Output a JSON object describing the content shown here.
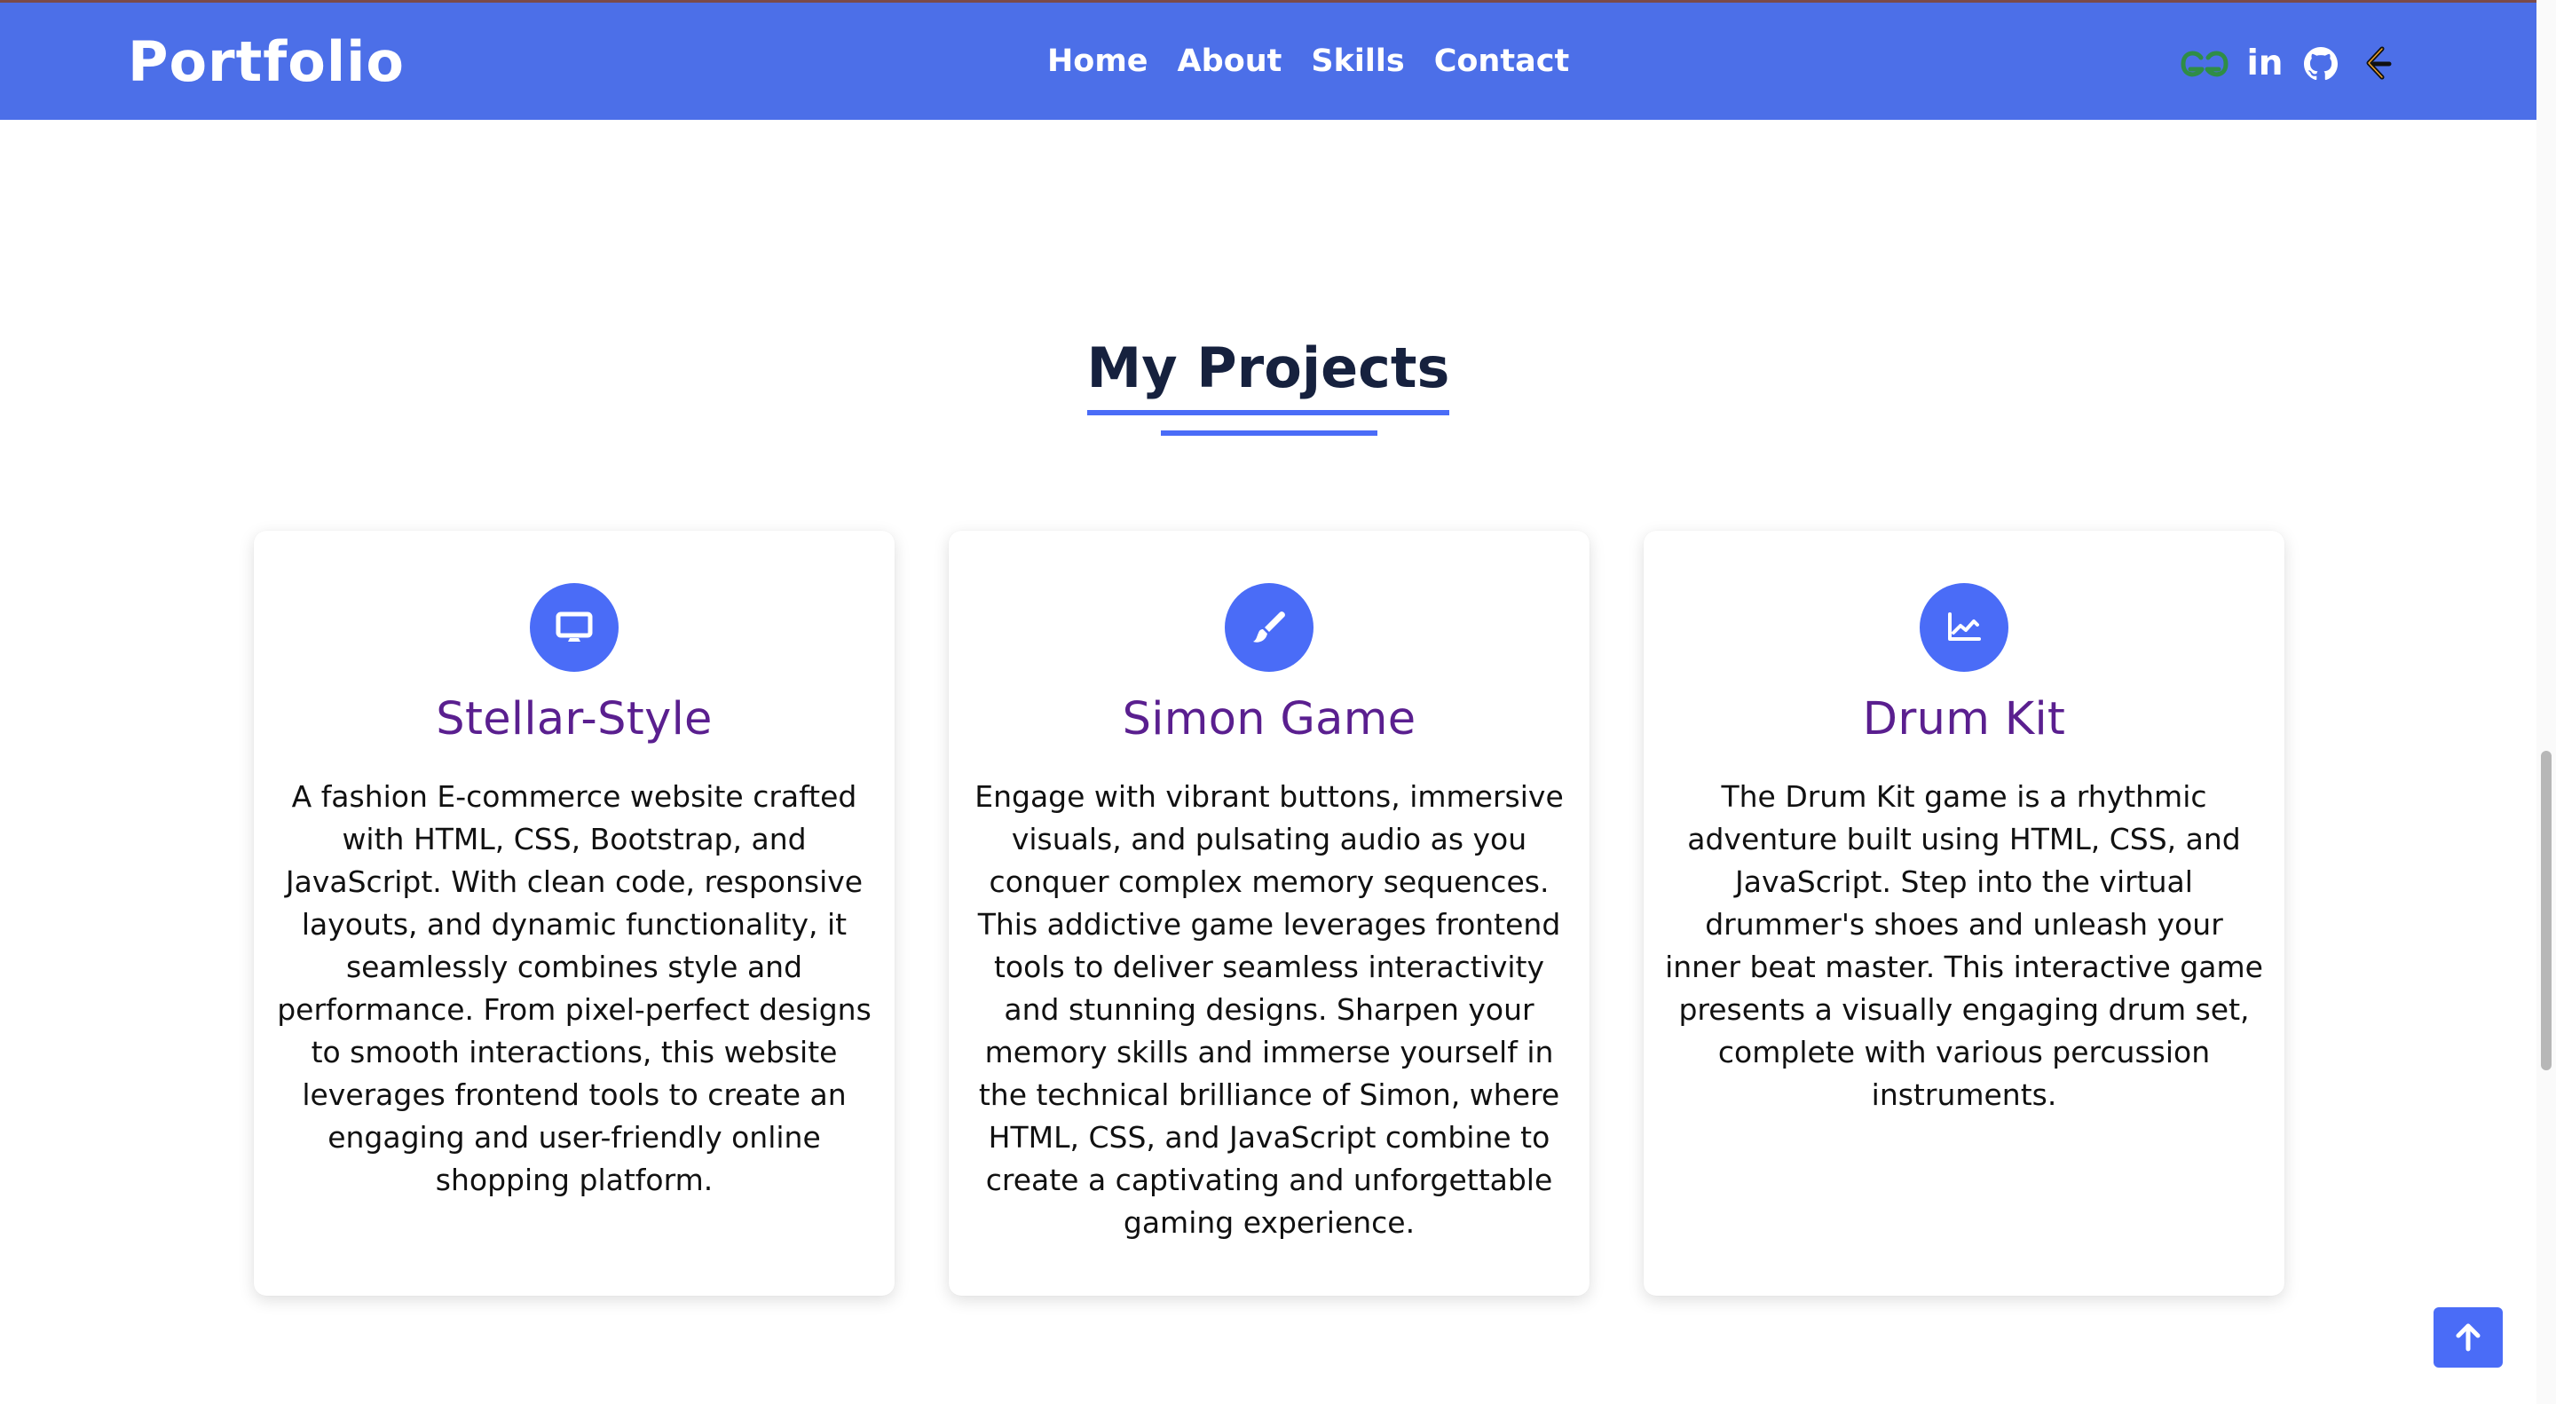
{
  "colors": {
    "navbar_background": "#4c6fe8",
    "accent": "#4a6cf7",
    "heading_text": "#16213e",
    "card_title": "#5a1f8f",
    "body_text": "#111111",
    "gfg_icon": "#2f8d46"
  },
  "navbar": {
    "brand": "Portfolio",
    "links": [
      {
        "label": "Home"
      },
      {
        "label": "About"
      },
      {
        "label": "Skills"
      },
      {
        "label": "Contact"
      }
    ],
    "socials": [
      {
        "name": "geeksforgeeks-icon"
      },
      {
        "name": "linkedin-icon",
        "text": "in"
      },
      {
        "name": "github-icon"
      },
      {
        "name": "leetcode-icon"
      }
    ]
  },
  "projects": {
    "title": "My Projects",
    "cards": [
      {
        "icon": "desktop-icon",
        "title": "Stellar-Style",
        "description": "A fashion E-commerce website crafted with HTML, CSS, Bootstrap, and JavaScript. With clean code, responsive layouts, and dynamic functionality, it seamlessly combines style and performance. From pixel-perfect designs to smooth interactions, this website leverages frontend tools to create an engaging and user-friendly online shopping platform."
      },
      {
        "icon": "paintbrush-icon",
        "title": "Simon Game",
        "description": "Engage with vibrant buttons, immersive visuals, and pulsating audio as you conquer complex memory sequences. This addictive game leverages frontend tools to deliver seamless interactivity and stunning designs. Sharpen your memory skills and immerse yourself in the technical brilliance of Simon, where HTML, CSS, and JavaScript combine to create a captivating and unforgettable gaming experience."
      },
      {
        "icon": "chart-line-icon",
        "title": "Drum Kit",
        "description": "The Drum Kit game is a rhythmic adventure built using HTML, CSS, and JavaScript. Step into the virtual drummer's shoes and unleash your inner beat master. This interactive game presents a visually engaging drum set, complete with various percussion instruments."
      }
    ]
  },
  "controls": {
    "back_to_top_icon": "arrow-up-icon"
  }
}
